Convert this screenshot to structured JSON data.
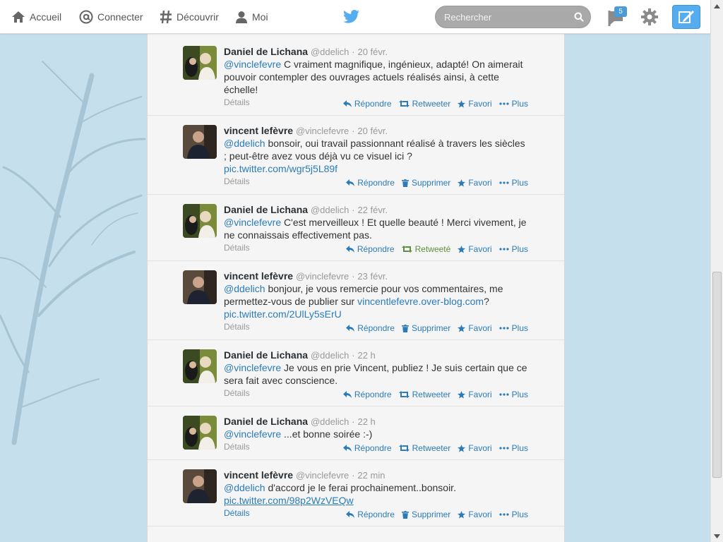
{
  "nav": {
    "home": "Accueil",
    "connect": "Connecter",
    "discover": "Découvrir",
    "me": "Moi"
  },
  "search": {
    "placeholder": "Rechercher"
  },
  "notifications": {
    "count": "5"
  },
  "actions_labels": {
    "reply": "Répondre",
    "retweet": "Retweeter",
    "retweeted": "Retweeté",
    "delete": "Supprimer",
    "favorite": "Favori",
    "more": "Plus",
    "details": "Détails"
  },
  "tweets": [
    {
      "name": "Daniel de Lichana",
      "handle": "@ddelich",
      "sep": "·",
      "time": "20 févr.",
      "mention": "@vinclefevre",
      "text": " C vraiment magnifique, ingénieux, adapté! On aimerait pouvoir contempler des ouvrages actuels réalisés ainsi, à cette échelle!",
      "link": "",
      "mid_link": "",
      "tail": ""
    },
    {
      "name": "vincent lefèvre",
      "handle": "@vinclefevre",
      "sep": "·",
      "time": "20 févr.",
      "mention": "@ddelich",
      "text": " bonsoir, oui travail passionnant réalisé à travers les siècles ; peut-être avez vous déjà vu ce visuel ici ?",
      "link": "pic.twitter.com/wgr5j5L89f",
      "mid_link": "",
      "tail": ""
    },
    {
      "name": "Daniel de Lichana",
      "handle": "@ddelich",
      "sep": "·",
      "time": "22 févr.",
      "mention": "@vinclefevre",
      "text": " C'est merveilleux ! Et quelle beauté ! Merci vivement, je ne connaissais effectivement pas.",
      "link": "",
      "mid_link": "",
      "tail": ""
    },
    {
      "name": "vincent lefèvre",
      "handle": "@vinclefevre",
      "sep": "·",
      "time": "23 févr.",
      "mention": "@ddelich",
      "text": " bonjour, je vous remercie pour vos commentaires, me permettez-vous de publier sur ",
      "link": "pic.twitter.com/2UlLy5sErU",
      "mid_link": "vincentlefevre.over-blog.com",
      "tail": "?"
    },
    {
      "name": "Daniel de Lichana",
      "handle": "@ddelich",
      "sep": "·",
      "time": "22 h",
      "mention": "@vinclefevre",
      "text": " Je vous en prie Vincent, publiez ! Je suis certain que ce sera fait avec conscience.",
      "link": "",
      "mid_link": "",
      "tail": ""
    },
    {
      "name": "Daniel de Lichana",
      "handle": "@ddelich",
      "sep": "·",
      "time": "22 h",
      "mention": "@vinclefevre",
      "text": " ...et bonne soirée :-)",
      "link": "",
      "mid_link": "",
      "tail": ""
    },
    {
      "name": "vincent lefèvre",
      "handle": "@vinclefevre",
      "sep": "·",
      "time": "22 min",
      "mention": "@ddelich",
      "text": " d'accord je le ferai prochainement..bonsoir.",
      "link": "pic.twitter.com/98p2WzVEQw",
      "mid_link": "",
      "tail": ""
    }
  ],
  "colors": {
    "accent": "#2b7bb9",
    "retweeted": "#5c913b",
    "background": "#c5dfec",
    "compose": "#55acee"
  }
}
